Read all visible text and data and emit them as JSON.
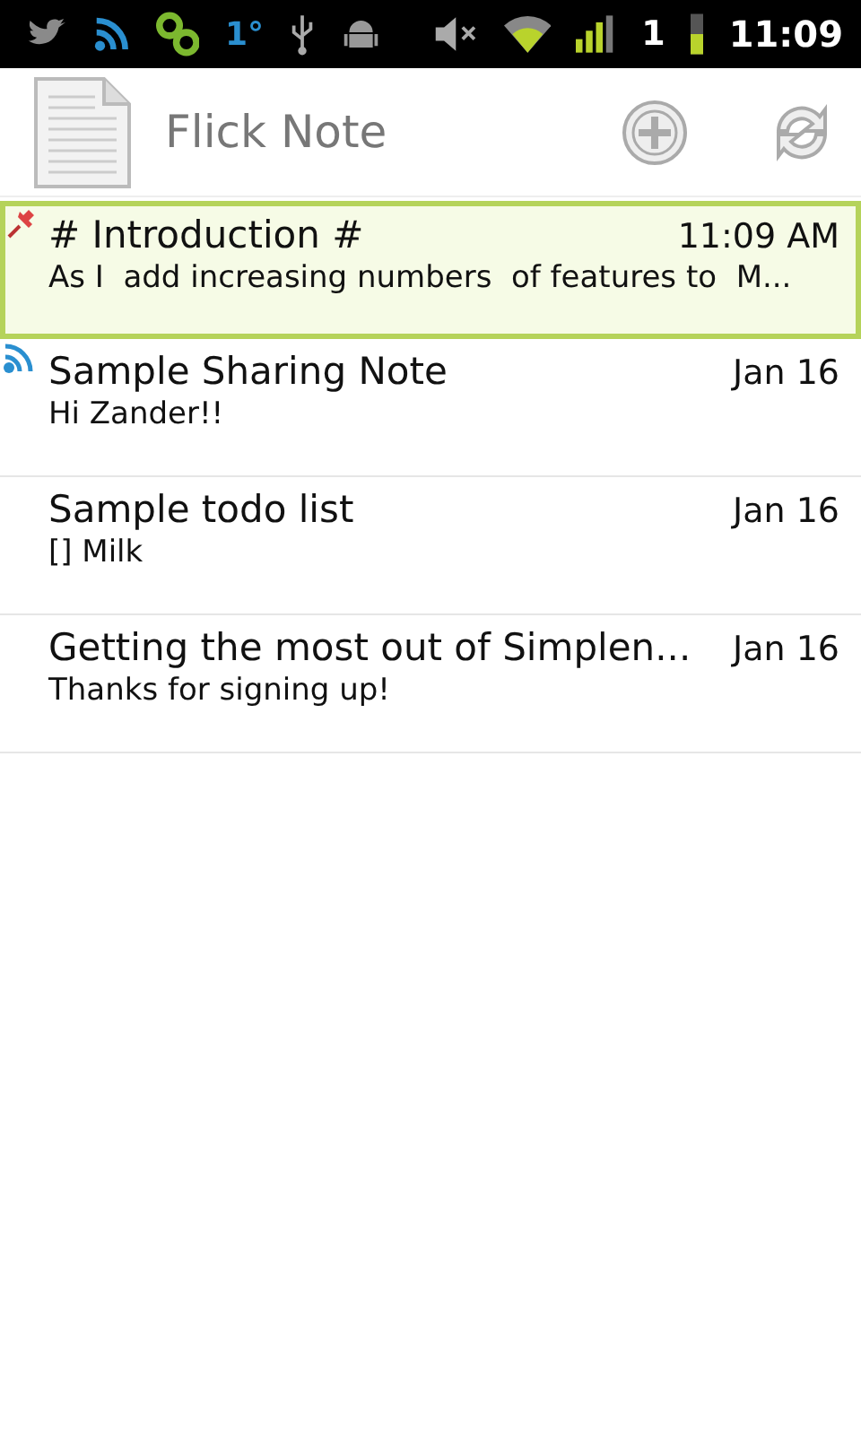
{
  "status_bar": {
    "temperature": "1°",
    "sim": "1",
    "time": "11:09"
  },
  "app_bar": {
    "title": "Flick Note"
  },
  "notes": [
    {
      "title": "# Introduction #",
      "preview": "As I  add increasing numbers  of features to  M...",
      "date": "11:09 AM",
      "selected": true,
      "kind": "pinned"
    },
    {
      "title": "Sample Sharing Note",
      "preview": "Hi Zander!!",
      "date": "Jan 16",
      "selected": false,
      "kind": "shared"
    },
    {
      "title": "Sample todo list",
      "preview": "[] Milk",
      "date": "Jan 16",
      "selected": false,
      "kind": "plain"
    },
    {
      "title": "Getting the most out of Simplen...",
      "preview": "Thanks for signing up!",
      "date": "Jan 16",
      "selected": false,
      "kind": "plain"
    }
  ]
}
